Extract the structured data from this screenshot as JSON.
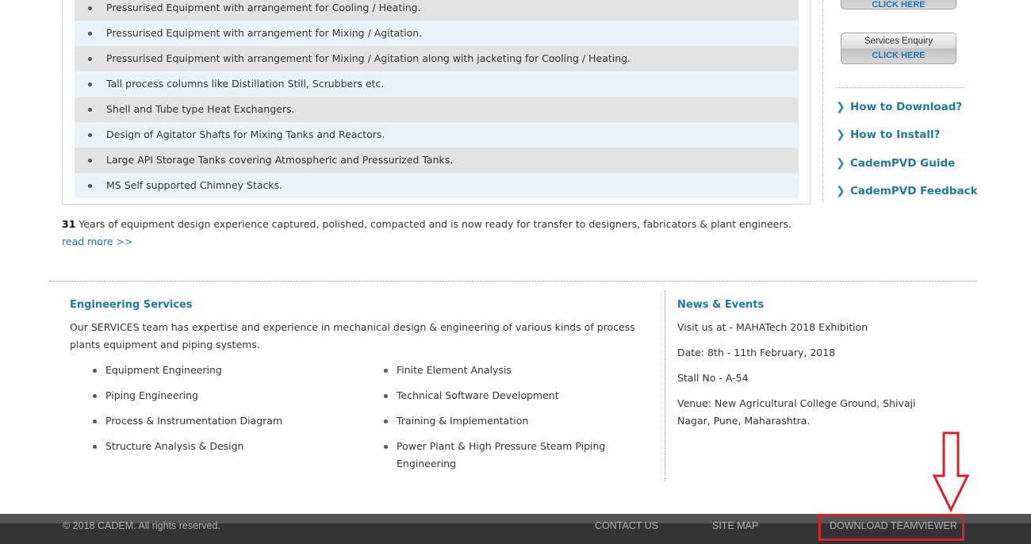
{
  "equipment_items": [
    "Pressurised Equipment with arrangement for Cooling / Heating.",
    "Pressurised Equipment with arrangement for Mixing / Agitation.",
    "Pressurised Equipment with arrangement for Mixing / Agitation along with jacketing for Cooling / Heating.",
    "Tall process columns like Distillation Still, Scrubbers etc.",
    "Shell and Tube type Heat Exchangers.",
    "Design of Agitator Shafts for Mixing Tanks and Reactors.",
    "Large API Storage Tanks covering Atmospheric and Pressurized Tanks.",
    "MS Self supported Chimney Stacks."
  ],
  "sidebar": {
    "top_button_cta": "CLICK HERE",
    "services_button": {
      "title": "Services Enquiry",
      "cta": "CLICK HERE"
    },
    "links": [
      "How to Download?",
      "How to Install?",
      "CademPVD Guide",
      "CademPVD Feedback"
    ]
  },
  "summary": {
    "years": "31",
    "text": " Years of equipment design experience captured, polished, compacted and is now ready for transfer to designers, fabricators & plant engineers. ",
    "read_more": "read more >>"
  },
  "engineering": {
    "title": "Engineering Services",
    "description": "Our SERVICES team has expertise and experience in mechanical design & engineering of various kinds of process plants equipment and piping systems.",
    "left_items": [
      "Equipment Engineering",
      "Piping Engineering",
      "Process & Instrumentation Diagram",
      "Structure Analysis & Design"
    ],
    "right_items": [
      "Finite Element Analysis",
      "Technical Software Development",
      "Training & Implementation",
      "Power Plant & High Pressure Steam Piping Engineering"
    ]
  },
  "news": {
    "title": "News & Events",
    "line1": "Visit us at - MAHATech 2018 Exhibition",
    "line2": "Date: 8th - 11th February, 2018",
    "line3": "Stall No - A-54",
    "line4": "Venue: New Agricultural College Ground, Shivaji Nagar, Pune, Maharashtra."
  },
  "footer": {
    "copyright": "© 2018 CADEM. All rights reserved.",
    "contact": "CONTACT US",
    "sitemap": "SITE MAP",
    "download": "DOWNLOAD TEAMVIEWER"
  },
  "annotation_color": "#d8222a",
  "accent_color": "#1b7aa6"
}
